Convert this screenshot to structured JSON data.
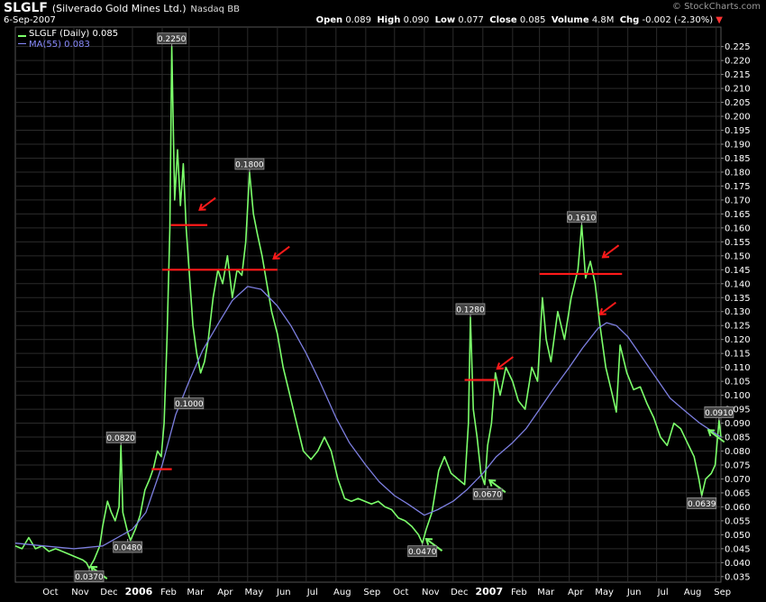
{
  "header": {
    "symbol": "SLGLF",
    "name": "(Silverado Gold Mines Ltd.)",
    "exchange": "Nasdaq BB",
    "date": "6-Sep-2007",
    "brand": "© StockCharts.com",
    "open_label": "Open",
    "open": "0.089",
    "high_label": "High",
    "high": "0.090",
    "low_label": "Low",
    "low": "0.077",
    "close_label": "Close",
    "close": "0.085",
    "volume_label": "Volume",
    "volume": "4.8M",
    "chg_label": "Chg",
    "chg": "-0.002 (-2.30%)"
  },
  "legend": {
    "price": "SLGLF (Daily) 0.085",
    "ma": "MA(55) 0.083"
  },
  "colors": {
    "background": "#000000",
    "grid": "#2b2b2b",
    "price_line": "#7cff6b",
    "ma_line": "#7d7fe0",
    "resistance_line": "#ff1a1a",
    "sell_arrow": "#ff1a1a",
    "buy_arrow": "#7cff6b",
    "axis_text": "#ffffff"
  },
  "chart_data": {
    "type": "line",
    "ylim": [
      0.033,
      0.232
    ],
    "y_ticks": [
      0.035,
      0.04,
      0.045,
      0.05,
      0.055,
      0.06,
      0.065,
      0.07,
      0.075,
      0.08,
      0.085,
      0.09,
      0.095,
      0.1,
      0.105,
      0.11,
      0.115,
      0.12,
      0.125,
      0.13,
      0.135,
      0.14,
      0.145,
      0.15,
      0.155,
      0.16,
      0.165,
      0.17,
      0.175,
      0.18,
      0.185,
      0.19,
      0.195,
      0.2,
      0.205,
      0.21,
      0.215,
      0.22,
      0.225
    ],
    "x_range": [
      "2005-09-01",
      "2007-09-06"
    ],
    "x_ticks": [
      {
        "date": "2005-10-01",
        "label": "Oct"
      },
      {
        "date": "2005-11-01",
        "label": "Nov"
      },
      {
        "date": "2005-12-01",
        "label": "Dec"
      },
      {
        "date": "2006-01-01",
        "label": "2006",
        "bold": true
      },
      {
        "date": "2006-02-01",
        "label": "Feb"
      },
      {
        "date": "2006-03-01",
        "label": "Mar"
      },
      {
        "date": "2006-04-01",
        "label": "Apr"
      },
      {
        "date": "2006-05-01",
        "label": "May"
      },
      {
        "date": "2006-06-01",
        "label": "Jun"
      },
      {
        "date": "2006-07-01",
        "label": "Jul"
      },
      {
        "date": "2006-08-01",
        "label": "Aug"
      },
      {
        "date": "2006-09-01",
        "label": "Sep"
      },
      {
        "date": "2006-10-01",
        "label": "Oct"
      },
      {
        "date": "2006-11-01",
        "label": "Nov"
      },
      {
        "date": "2006-12-01",
        "label": "Dec"
      },
      {
        "date": "2007-01-01",
        "label": "2007",
        "bold": true
      },
      {
        "date": "2007-02-01",
        "label": "Feb"
      },
      {
        "date": "2007-03-01",
        "label": "Mar"
      },
      {
        "date": "2007-04-01",
        "label": "Apr"
      },
      {
        "date": "2007-05-01",
        "label": "May"
      },
      {
        "date": "2007-06-01",
        "label": "Jun"
      },
      {
        "date": "2007-07-01",
        "label": "Jul"
      },
      {
        "date": "2007-08-01",
        "label": "Aug"
      },
      {
        "date": "2007-09-01",
        "label": "Sep"
      }
    ],
    "series": [
      {
        "name": "SLGLF (Daily)",
        "points": [
          [
            "2005-09-01",
            0.046
          ],
          [
            "2005-09-08",
            0.045
          ],
          [
            "2005-09-15",
            0.049
          ],
          [
            "2005-09-22",
            0.045
          ],
          [
            "2005-09-29",
            0.046
          ],
          [
            "2005-10-06",
            0.044
          ],
          [
            "2005-10-13",
            0.045
          ],
          [
            "2005-10-20",
            0.044
          ],
          [
            "2005-10-27",
            0.043
          ],
          [
            "2005-11-03",
            0.042
          ],
          [
            "2005-11-10",
            0.041
          ],
          [
            "2005-11-14",
            0.04
          ],
          [
            "2005-11-17",
            0.038
          ],
          [
            "2005-11-22",
            0.041
          ],
          [
            "2005-11-28",
            0.046
          ],
          [
            "2005-12-01",
            0.053
          ],
          [
            "2005-12-06",
            0.062
          ],
          [
            "2005-12-10",
            0.058
          ],
          [
            "2005-12-14",
            0.055
          ],
          [
            "2005-12-18",
            0.06
          ],
          [
            "2005-12-20",
            0.082
          ],
          [
            "2005-12-22",
            0.058
          ],
          [
            "2005-12-27",
            0.051
          ],
          [
            "2005-12-30",
            0.048
          ],
          [
            "2006-01-04",
            0.052
          ],
          [
            "2006-01-09",
            0.057
          ],
          [
            "2006-01-14",
            0.066
          ],
          [
            "2006-01-19",
            0.07
          ],
          [
            "2006-01-23",
            0.074
          ],
          [
            "2006-01-27",
            0.08
          ],
          [
            "2006-01-31",
            0.078
          ],
          [
            "2006-02-03",
            0.09
          ],
          [
            "2006-02-06",
            0.12
          ],
          [
            "2006-02-09",
            0.16
          ],
          [
            "2006-02-11",
            0.225
          ],
          [
            "2006-02-14",
            0.17
          ],
          [
            "2006-02-17",
            0.188
          ],
          [
            "2006-02-20",
            0.168
          ],
          [
            "2006-02-23",
            0.183
          ],
          [
            "2006-02-26",
            0.16
          ],
          [
            "2006-03-01",
            0.145
          ],
          [
            "2006-03-05",
            0.125
          ],
          [
            "2006-03-09",
            0.115
          ],
          [
            "2006-03-13",
            0.108
          ],
          [
            "2006-03-17",
            0.112
          ],
          [
            "2006-03-21",
            0.12
          ],
          [
            "2006-03-26",
            0.135
          ],
          [
            "2006-03-31",
            0.145
          ],
          [
            "2006-04-05",
            0.14
          ],
          [
            "2006-04-10",
            0.15
          ],
          [
            "2006-04-15",
            0.135
          ],
          [
            "2006-04-20",
            0.145
          ],
          [
            "2006-04-25",
            0.143
          ],
          [
            "2006-04-29",
            0.155
          ],
          [
            "2006-05-03",
            0.18
          ],
          [
            "2006-05-07",
            0.165
          ],
          [
            "2006-05-11",
            0.158
          ],
          [
            "2006-05-16",
            0.15
          ],
          [
            "2006-05-21",
            0.14
          ],
          [
            "2006-05-26",
            0.13
          ],
          [
            "2006-06-01",
            0.122
          ],
          [
            "2006-06-07",
            0.11
          ],
          [
            "2006-06-14",
            0.1
          ],
          [
            "2006-06-21",
            0.09
          ],
          [
            "2006-06-28",
            0.08
          ],
          [
            "2006-07-06",
            0.077
          ],
          [
            "2006-07-13",
            0.08
          ],
          [
            "2006-07-20",
            0.085
          ],
          [
            "2006-07-27",
            0.08
          ],
          [
            "2006-08-03",
            0.07
          ],
          [
            "2006-08-10",
            0.063
          ],
          [
            "2006-08-17",
            0.062
          ],
          [
            "2006-08-24",
            0.063
          ],
          [
            "2006-08-31",
            0.062
          ],
          [
            "2006-09-07",
            0.061
          ],
          [
            "2006-09-14",
            0.062
          ],
          [
            "2006-09-21",
            0.06
          ],
          [
            "2006-09-28",
            0.059
          ],
          [
            "2006-10-05",
            0.056
          ],
          [
            "2006-10-12",
            0.055
          ],
          [
            "2006-10-19",
            0.053
          ],
          [
            "2006-10-26",
            0.05
          ],
          [
            "2006-10-30",
            0.047
          ],
          [
            "2006-11-03",
            0.052
          ],
          [
            "2006-11-09",
            0.058
          ],
          [
            "2006-11-16",
            0.073
          ],
          [
            "2006-11-22",
            0.078
          ],
          [
            "2006-11-29",
            0.072
          ],
          [
            "2006-12-06",
            0.07
          ],
          [
            "2006-12-13",
            0.068
          ],
          [
            "2006-12-17",
            0.09
          ],
          [
            "2006-12-19",
            0.128
          ],
          [
            "2006-12-22",
            0.095
          ],
          [
            "2006-12-26",
            0.085
          ],
          [
            "2006-12-30",
            0.072
          ],
          [
            "2007-01-03",
            0.068
          ],
          [
            "2007-01-06",
            0.082
          ],
          [
            "2007-01-10",
            0.09
          ],
          [
            "2007-01-14",
            0.108
          ],
          [
            "2007-01-19",
            0.1
          ],
          [
            "2007-01-25",
            0.11
          ],
          [
            "2007-02-01",
            0.105
          ],
          [
            "2007-02-07",
            0.098
          ],
          [
            "2007-02-14",
            0.095
          ],
          [
            "2007-02-21",
            0.11
          ],
          [
            "2007-02-27",
            0.105
          ],
          [
            "2007-03-04",
            0.135
          ],
          [
            "2007-03-08",
            0.12
          ],
          [
            "2007-03-13",
            0.112
          ],
          [
            "2007-03-20",
            0.13
          ],
          [
            "2007-03-27",
            0.12
          ],
          [
            "2007-04-03",
            0.135
          ],
          [
            "2007-04-10",
            0.145
          ],
          [
            "2007-04-14",
            0.161
          ],
          [
            "2007-04-18",
            0.142
          ],
          [
            "2007-04-23",
            0.148
          ],
          [
            "2007-04-28",
            0.14
          ],
          [
            "2007-05-03",
            0.125
          ],
          [
            "2007-05-09",
            0.11
          ],
          [
            "2007-05-16",
            0.1
          ],
          [
            "2007-05-20",
            0.094
          ],
          [
            "2007-05-24",
            0.118
          ],
          [
            "2007-05-31",
            0.108
          ],
          [
            "2007-06-07",
            0.102
          ],
          [
            "2007-06-14",
            0.103
          ],
          [
            "2007-06-21",
            0.097
          ],
          [
            "2007-06-28",
            0.092
          ],
          [
            "2007-07-05",
            0.085
          ],
          [
            "2007-07-12",
            0.082
          ],
          [
            "2007-07-19",
            0.09
          ],
          [
            "2007-07-26",
            0.088
          ],
          [
            "2007-08-02",
            0.083
          ],
          [
            "2007-08-09",
            0.078
          ],
          [
            "2007-08-14",
            0.07
          ],
          [
            "2007-08-17",
            0.064
          ],
          [
            "2007-08-21",
            0.07
          ],
          [
            "2007-08-27",
            0.072
          ],
          [
            "2007-08-31",
            0.075
          ],
          [
            "2007-09-04",
            0.091
          ],
          [
            "2007-09-06",
            0.085
          ]
        ]
      },
      {
        "name": "MA(55)",
        "points": [
          [
            "2005-09-01",
            0.047
          ],
          [
            "2005-10-01",
            0.046
          ],
          [
            "2005-11-01",
            0.045
          ],
          [
            "2005-12-01",
            0.046
          ],
          [
            "2006-01-01",
            0.052
          ],
          [
            "2006-01-15",
            0.058
          ],
          [
            "2006-02-01",
            0.075
          ],
          [
            "2006-02-15",
            0.093
          ],
          [
            "2006-03-01",
            0.105
          ],
          [
            "2006-03-15",
            0.116
          ],
          [
            "2006-04-01",
            0.126
          ],
          [
            "2006-04-15",
            0.134
          ],
          [
            "2006-05-01",
            0.139
          ],
          [
            "2006-05-15",
            0.138
          ],
          [
            "2006-06-01",
            0.132
          ],
          [
            "2006-06-15",
            0.125
          ],
          [
            "2006-07-01",
            0.115
          ],
          [
            "2006-07-15",
            0.105
          ],
          [
            "2006-08-01",
            0.092
          ],
          [
            "2006-08-15",
            0.083
          ],
          [
            "2006-09-01",
            0.075
          ],
          [
            "2006-09-15",
            0.069
          ],
          [
            "2006-10-01",
            0.064
          ],
          [
            "2006-10-15",
            0.061
          ],
          [
            "2006-11-01",
            0.057
          ],
          [
            "2006-11-15",
            0.059
          ],
          [
            "2006-12-01",
            0.062
          ],
          [
            "2006-12-15",
            0.066
          ],
          [
            "2007-01-01",
            0.072
          ],
          [
            "2007-01-15",
            0.078
          ],
          [
            "2007-02-01",
            0.083
          ],
          [
            "2007-02-15",
            0.088
          ],
          [
            "2007-03-01",
            0.095
          ],
          [
            "2007-03-15",
            0.102
          ],
          [
            "2007-04-01",
            0.11
          ],
          [
            "2007-04-15",
            0.117
          ],
          [
            "2007-05-01",
            0.124
          ],
          [
            "2007-05-10",
            0.126
          ],
          [
            "2007-05-20",
            0.125
          ],
          [
            "2007-06-01",
            0.121
          ],
          [
            "2007-06-15",
            0.114
          ],
          [
            "2007-07-01",
            0.106
          ],
          [
            "2007-07-15",
            0.099
          ],
          [
            "2007-08-01",
            0.094
          ],
          [
            "2007-08-15",
            0.09
          ],
          [
            "2007-09-06",
            0.085
          ]
        ]
      }
    ],
    "annotations": [
      {
        "date": "2006-02-11",
        "value": 0.225,
        "text": "0.2250",
        "pos": "above"
      },
      {
        "date": "2006-05-03",
        "value": 0.18,
        "text": "0.1800",
        "pos": "above"
      },
      {
        "date": "2006-03-01",
        "value": 0.1,
        "text": "0.1000",
        "pos": "below"
      },
      {
        "date": "2005-12-20",
        "value": 0.082,
        "text": "0.0820",
        "pos": "above"
      },
      {
        "date": "2005-12-27",
        "value": 0.0485,
        "text": "0.0480",
        "pos": "below"
      },
      {
        "date": "2005-11-17",
        "value": 0.038,
        "text": "0.0370",
        "pos": "below"
      },
      {
        "date": "2006-10-30",
        "value": 0.047,
        "text": "0.0470",
        "pos": "below"
      },
      {
        "date": "2006-12-19",
        "value": 0.128,
        "text": "0.1280",
        "pos": "above"
      },
      {
        "date": "2007-01-06",
        "value": 0.0675,
        "text": "0.0670",
        "pos": "below"
      },
      {
        "date": "2007-04-14",
        "value": 0.161,
        "text": "0.1610",
        "pos": "above"
      },
      {
        "date": "2007-08-17",
        "value": 0.0642,
        "text": "0.0639",
        "pos": "below"
      },
      {
        "date": "2007-09-04",
        "value": 0.091,
        "text": "0.0910",
        "pos": "above"
      }
    ],
    "resistance_lines": [
      {
        "from": "2006-02-10",
        "to": "2006-03-20",
        "value": 0.161
      },
      {
        "from": "2006-02-01",
        "to": "2006-06-01",
        "value": 0.145
      },
      {
        "from": "2006-01-21",
        "to": "2006-02-11",
        "value": 0.0735
      },
      {
        "from": "2006-12-13",
        "to": "2007-01-14",
        "value": 0.1055
      },
      {
        "from": "2007-03-01",
        "to": "2007-05-26",
        "value": 0.1435
      }
    ],
    "sell_arrows": [
      {
        "date": "2006-03-12",
        "value": 0.1665
      },
      {
        "date": "2006-05-28",
        "value": 0.149
      },
      {
        "date": "2007-01-16",
        "value": 0.1095
      },
      {
        "date": "2007-05-06",
        "value": 0.1495
      },
      {
        "date": "2007-05-03",
        "value": 0.129
      }
    ],
    "buy_arrows": [
      {
        "date": "2005-11-19",
        "value": 0.0385
      },
      {
        "date": "2006-11-03",
        "value": 0.0485
      },
      {
        "date": "2007-01-08",
        "value": 0.0695
      },
      {
        "date": "2007-08-24",
        "value": 0.0875
      }
    ],
    "grid": true
  }
}
